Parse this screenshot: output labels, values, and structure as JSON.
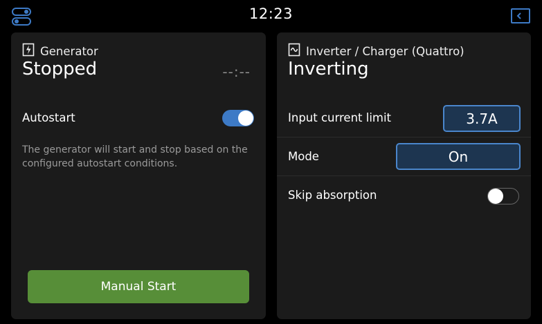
{
  "topbar": {
    "time": "12:23",
    "left_icon": "toggles-icon",
    "right_icon": "sidebar-icon"
  },
  "generator": {
    "icon": "lightning-icon",
    "title": "Generator",
    "state": "Stopped",
    "runtime": "--:--",
    "autostart_label": "Autostart",
    "autostart_enabled": true,
    "description": "The generator will start and stop based on the configured autostart conditions.",
    "manual_start_label": "Manual Start"
  },
  "inverter": {
    "icon": "waveform-icon",
    "title": "Inverter / Charger (Quattro)",
    "state": "Inverting",
    "input_current_limit_label": "Input current limit",
    "input_current_limit_value": "3.7A",
    "mode_label": "Mode",
    "mode_value": "On",
    "skip_absorption_label": "Skip absorption",
    "skip_absorption_enabled": false
  },
  "colors": {
    "background": "#000000",
    "card": "#1b1b1b",
    "accent_blue": "#3d7ac6",
    "button_green": "#578e38",
    "value_button_bg": "#1d3550"
  }
}
